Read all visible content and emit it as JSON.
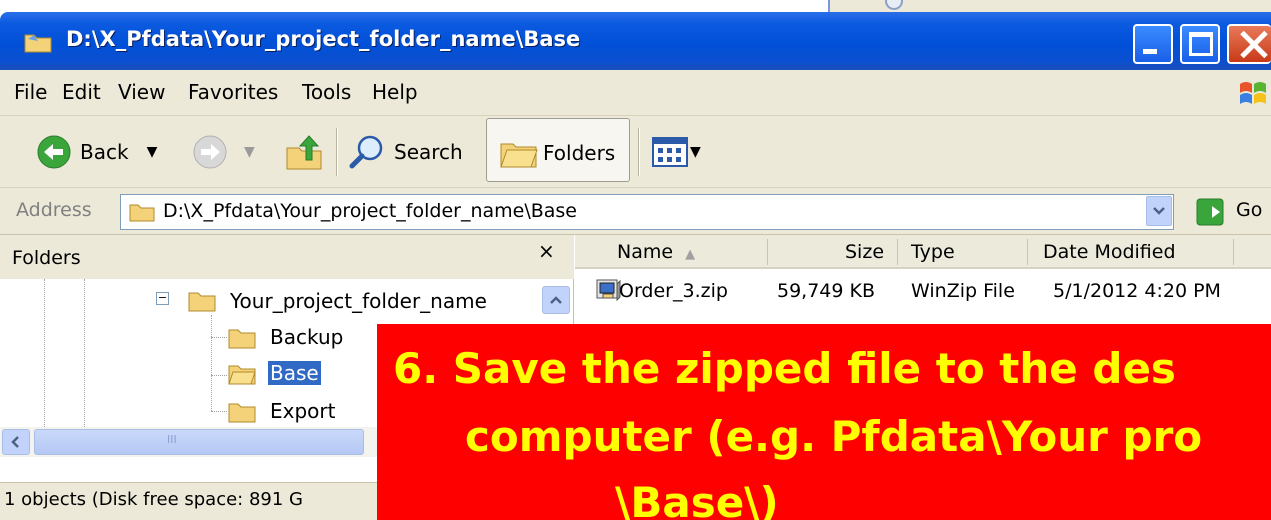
{
  "window": {
    "title": "D:\\X_Pfdata\\Your_project_folder_name\\Base"
  },
  "menu": [
    "File",
    "Edit",
    "View",
    "Favorites",
    "Tools",
    "Help"
  ],
  "toolbar": {
    "back_label": "Back",
    "search_label": "Search",
    "folders_label": "Folders"
  },
  "address": {
    "label": "Address",
    "value": "D:\\X_Pfdata\\Your_project_folder_name\\Base",
    "go_label": "Go"
  },
  "folders_pane": {
    "title": "Folders",
    "close_glyph": "×",
    "tree": [
      {
        "label": "Your_project_folder_name",
        "level": 1,
        "selected": false
      },
      {
        "label": "Backup",
        "level": 2,
        "selected": false
      },
      {
        "label": "Base",
        "level": 2,
        "selected": true
      },
      {
        "label": "Export",
        "level": 2,
        "selected": false
      }
    ],
    "hscroll_grip": "III"
  },
  "file_list": {
    "columns": [
      "Name",
      "Size",
      "Type",
      "Date Modified"
    ],
    "sort_indicator": "▲",
    "rows": [
      {
        "name": "Order_3.zip",
        "size": "59,749 KB",
        "type": "WinZip File",
        "date_modified": "5/1/2012 4:20 PM"
      }
    ]
  },
  "status": {
    "text": "1 objects (Disk free space: 891 G"
  },
  "callout": {
    "line1": "6.  Save the zipped file to the des",
    "line2": "computer (e.g. Pfdata\\Your pro",
    "line3": "\\Base\\)"
  },
  "colors": {
    "title_blue": "#0150d8",
    "callout_bg": "#ff0000",
    "callout_text": "#ffff00",
    "selection": "#316ac5"
  }
}
